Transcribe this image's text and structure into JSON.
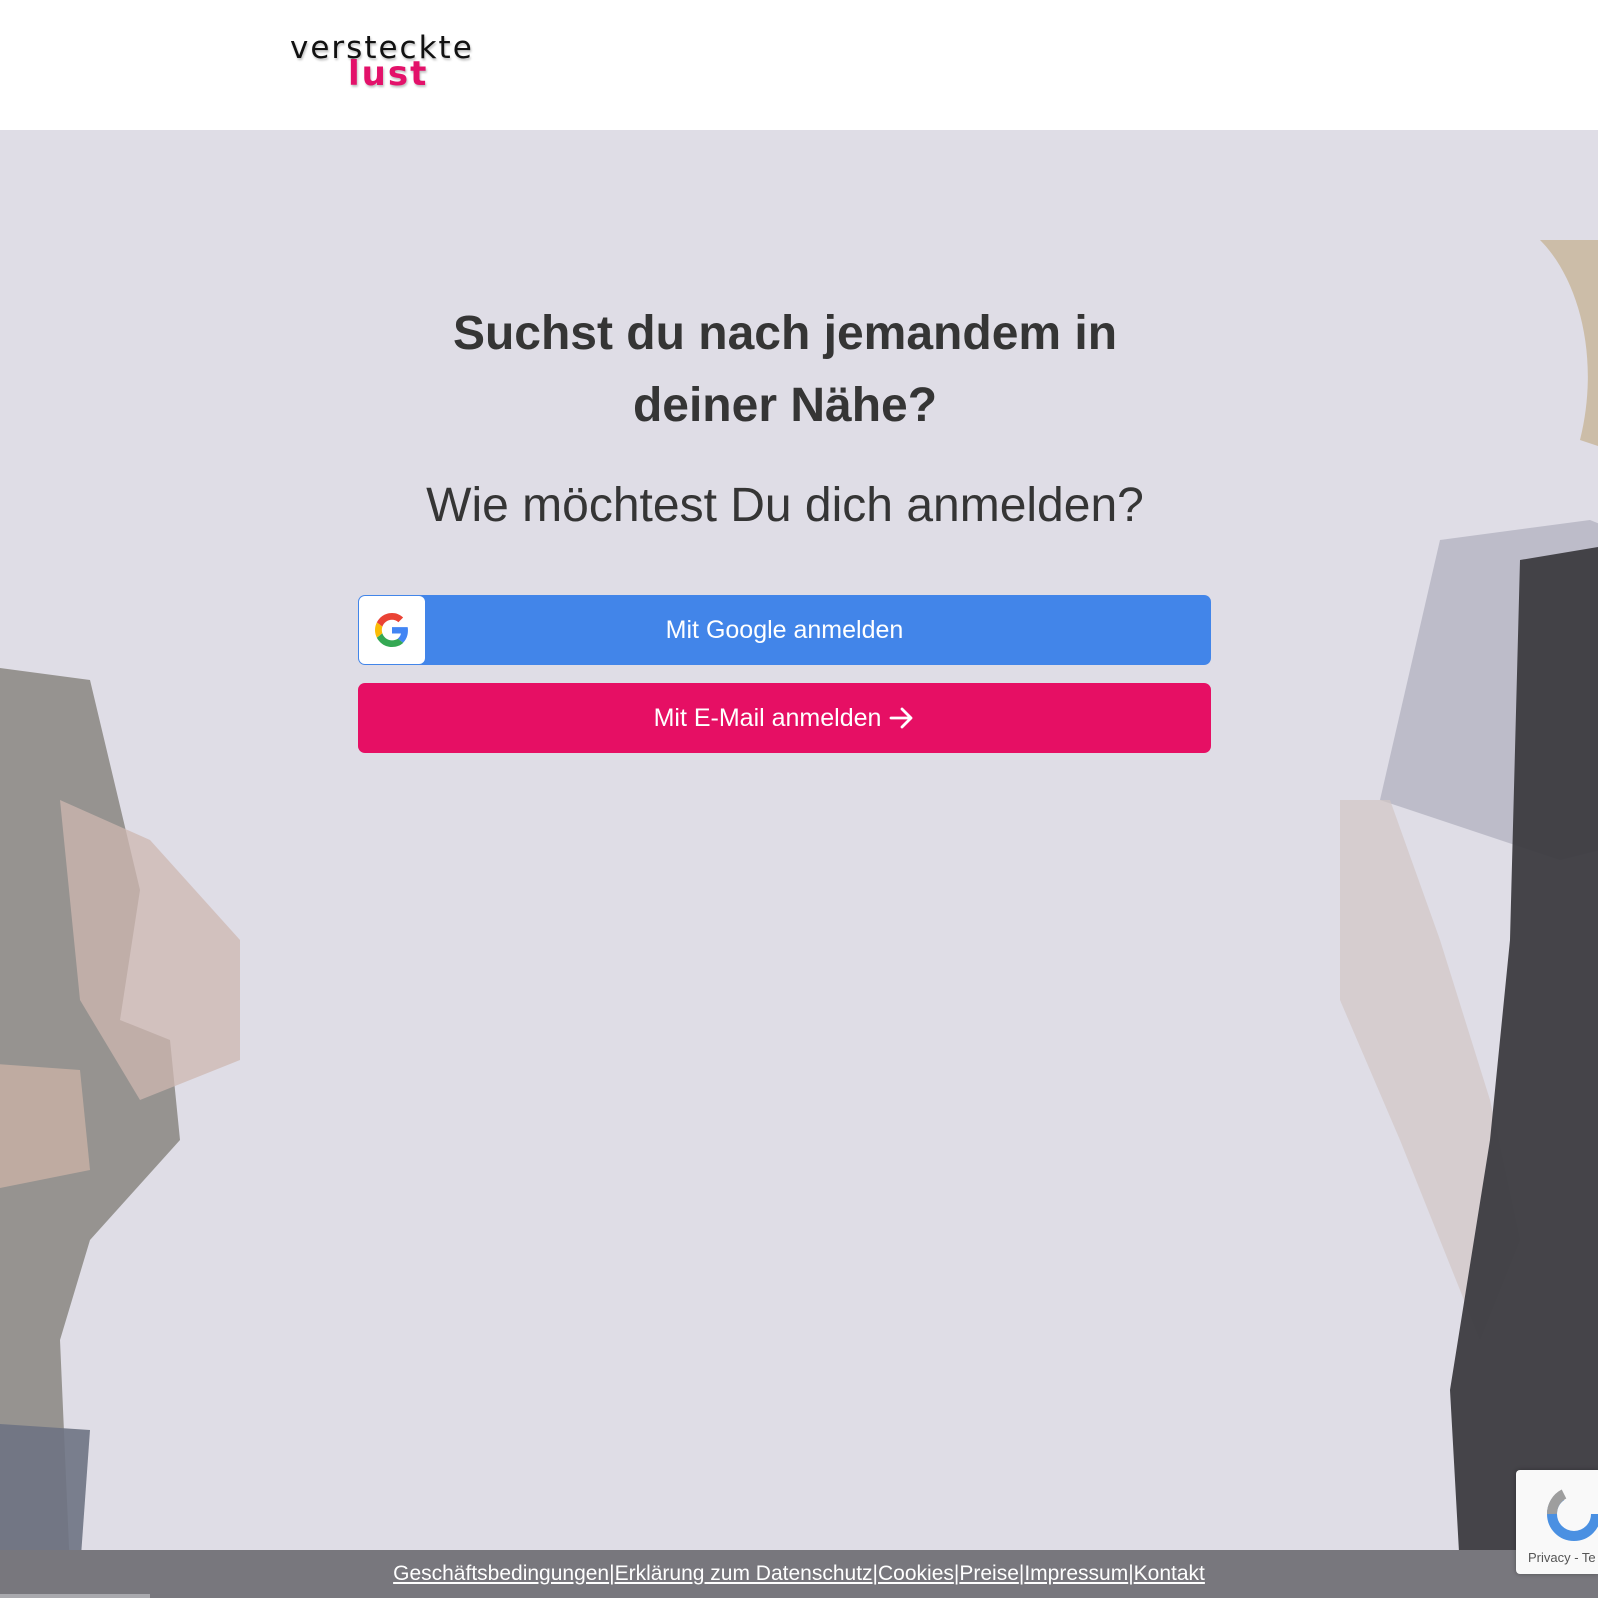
{
  "header": {
    "logo_top": "versteckte",
    "logo_bottom": "lust"
  },
  "main": {
    "headline": "Suchst du nach jemandem in deiner Nähe?",
    "subheadline": "Wie möchtest Du dich anmelden?",
    "google_button": {
      "label": "Mit Google anmelden",
      "icon": "google-icon",
      "color": "#4285e9"
    },
    "email_button": {
      "label": "Mit E-Mail anmelden",
      "icon": "arrow-right-icon",
      "color": "#e60f64"
    }
  },
  "footer": {
    "links": [
      {
        "label": "Geschäftsbedingungen "
      },
      {
        "label": " Erklärung zum Datenschutz "
      },
      {
        "label": " Cookies "
      },
      {
        "label": " Preise "
      },
      {
        "label": " Impressum "
      },
      {
        "label": " Kontakt"
      }
    ],
    "separator": "|"
  },
  "recaptcha": {
    "text": "Privacy - Te"
  },
  "colors": {
    "brand_pink": "#e3116a",
    "google_blue": "#4285e9",
    "background": "#dfdde6",
    "footer": "#78777d"
  }
}
